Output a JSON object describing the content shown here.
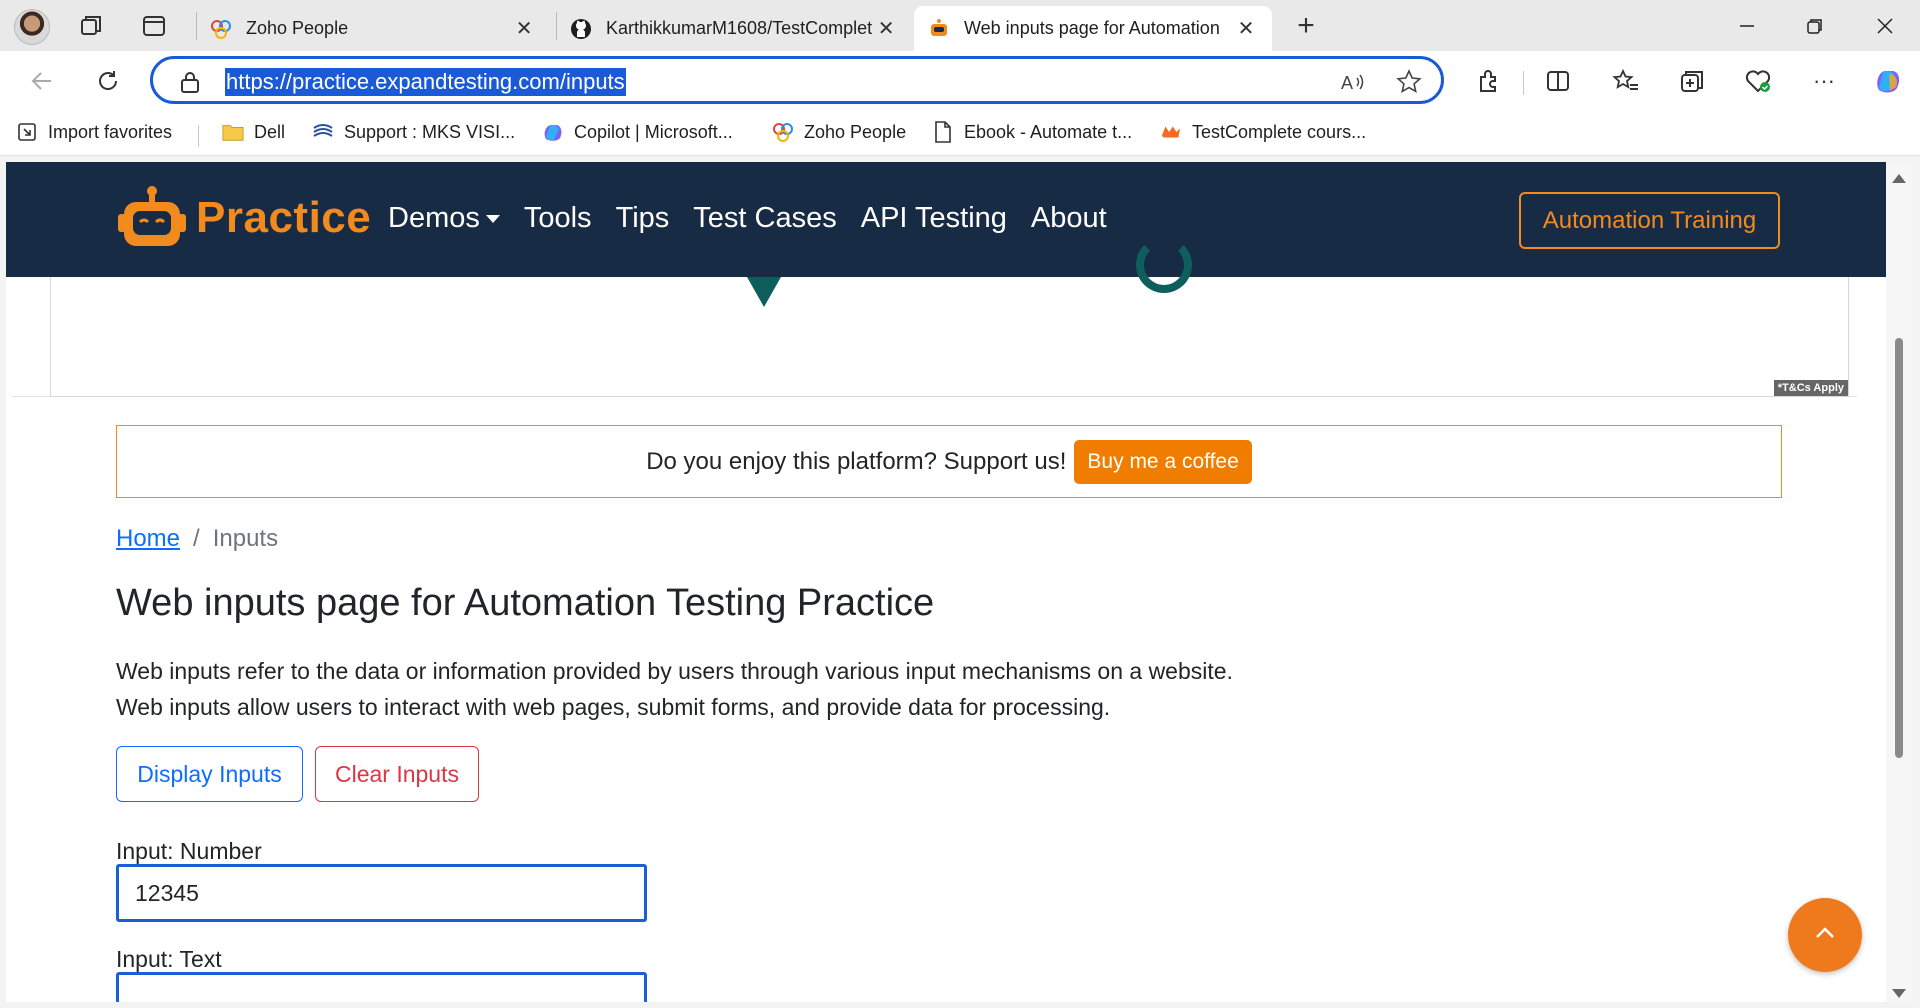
{
  "browser": {
    "tabs": [
      {
        "title": "Zoho People",
        "favicon": "zoho-icon"
      },
      {
        "title": "KarthikkumarM1608/TestComplet",
        "favicon": "github-icon"
      },
      {
        "title": "Web inputs page for Automation",
        "favicon": "robot-icon",
        "active": true
      }
    ],
    "url": "https://practice.expandtesting.com/inputs",
    "favorites": [
      {
        "label": "Import favorites",
        "icon": "import-icon"
      },
      {
        "label": "Dell",
        "icon": "folder-icon"
      },
      {
        "label": "Support : MKS VISI...",
        "icon": "mks-icon"
      },
      {
        "label": "Copilot | Microsoft...",
        "icon": "copilot-icon"
      },
      {
        "label": "Zoho People",
        "icon": "zoho-icon"
      },
      {
        "label": "Ebook - Automate t...",
        "icon": "page-icon"
      },
      {
        "label": "TestComplete cours...",
        "icon": "testcomplete-icon"
      }
    ]
  },
  "site": {
    "brand": "Practice",
    "nav": [
      "Demos",
      "Tools",
      "Tips",
      "Test Cases",
      "API Testing",
      "About"
    ],
    "training_button": "Automation Training",
    "ad_badge": "*T&Cs Apply",
    "support_text": "Do you enjoy this platform? Support us!",
    "coffee_button": "Buy me a coffee",
    "breadcrumb": {
      "home": "Home",
      "separator": "/",
      "current": "Inputs"
    },
    "title": "Web inputs page for Automation Testing Practice",
    "description": [
      "Web inputs refer to the data or information provided by users through various input mechanisms on a website.",
      "Web inputs allow users to interact with web pages, submit forms, and provide data for processing."
    ],
    "display_button": "Display Inputs",
    "clear_button": "Clear Inputs",
    "inputs": [
      {
        "label": "Input: Number",
        "value": "12345"
      },
      {
        "label": "Input: Text",
        "value": ""
      }
    ]
  },
  "colors": {
    "nav_bg": "#172b45",
    "brand_orange": "#f28a1d",
    "link_blue": "#0d6efd",
    "danger_red": "#dc3545",
    "focus_blue": "#1b5fd6"
  }
}
